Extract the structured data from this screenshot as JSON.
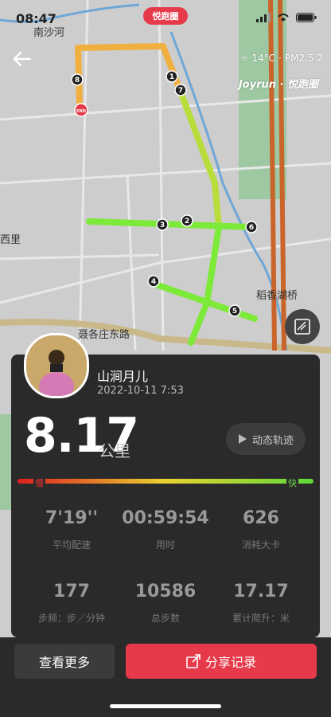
{
  "status": {
    "time": "08:47"
  },
  "header": {
    "brand_label": "悦跑圈"
  },
  "weather": {
    "temperature": "14°C",
    "aqi": "PM2.5 2"
  },
  "brand": {
    "name": "Joyrun · 悦跑圈"
  },
  "map": {
    "labels": {
      "river": "南沙河",
      "west": "西里",
      "lake_bridge": "稻香湖桥",
      "road": "聂各庄东路"
    },
    "markers": [
      "8",
      "1",
      "7",
      "3",
      "2",
      "6",
      "4",
      "5"
    ],
    "end_marker": "END"
  },
  "user": {
    "name": "山涧月儿",
    "datetime": "2022-10-11 7:53"
  },
  "run": {
    "distance": "8.17",
    "unit": "公里"
  },
  "replay": {
    "label": "动态轨迹"
  },
  "pace_legend": {
    "slow": "慢",
    "fast": "快"
  },
  "stats": [
    {
      "value": "7'19''",
      "label": "平均配速"
    },
    {
      "value": "00:59:54",
      "label": "用时"
    },
    {
      "value": "626",
      "label": "消耗大卡"
    },
    {
      "value": "177",
      "label": "步频：步／分钟"
    },
    {
      "value": "10586",
      "label": "总步数"
    },
    {
      "value": "17.17",
      "label": "累计爬升：米"
    }
  ],
  "actions": {
    "more": "查看更多",
    "share": "分享记录"
  },
  "colors": {
    "accent": "#e63a4a",
    "panel": "#2a2a2a",
    "route_fast": "#7dea3a",
    "route_slow": "#f0b040"
  }
}
